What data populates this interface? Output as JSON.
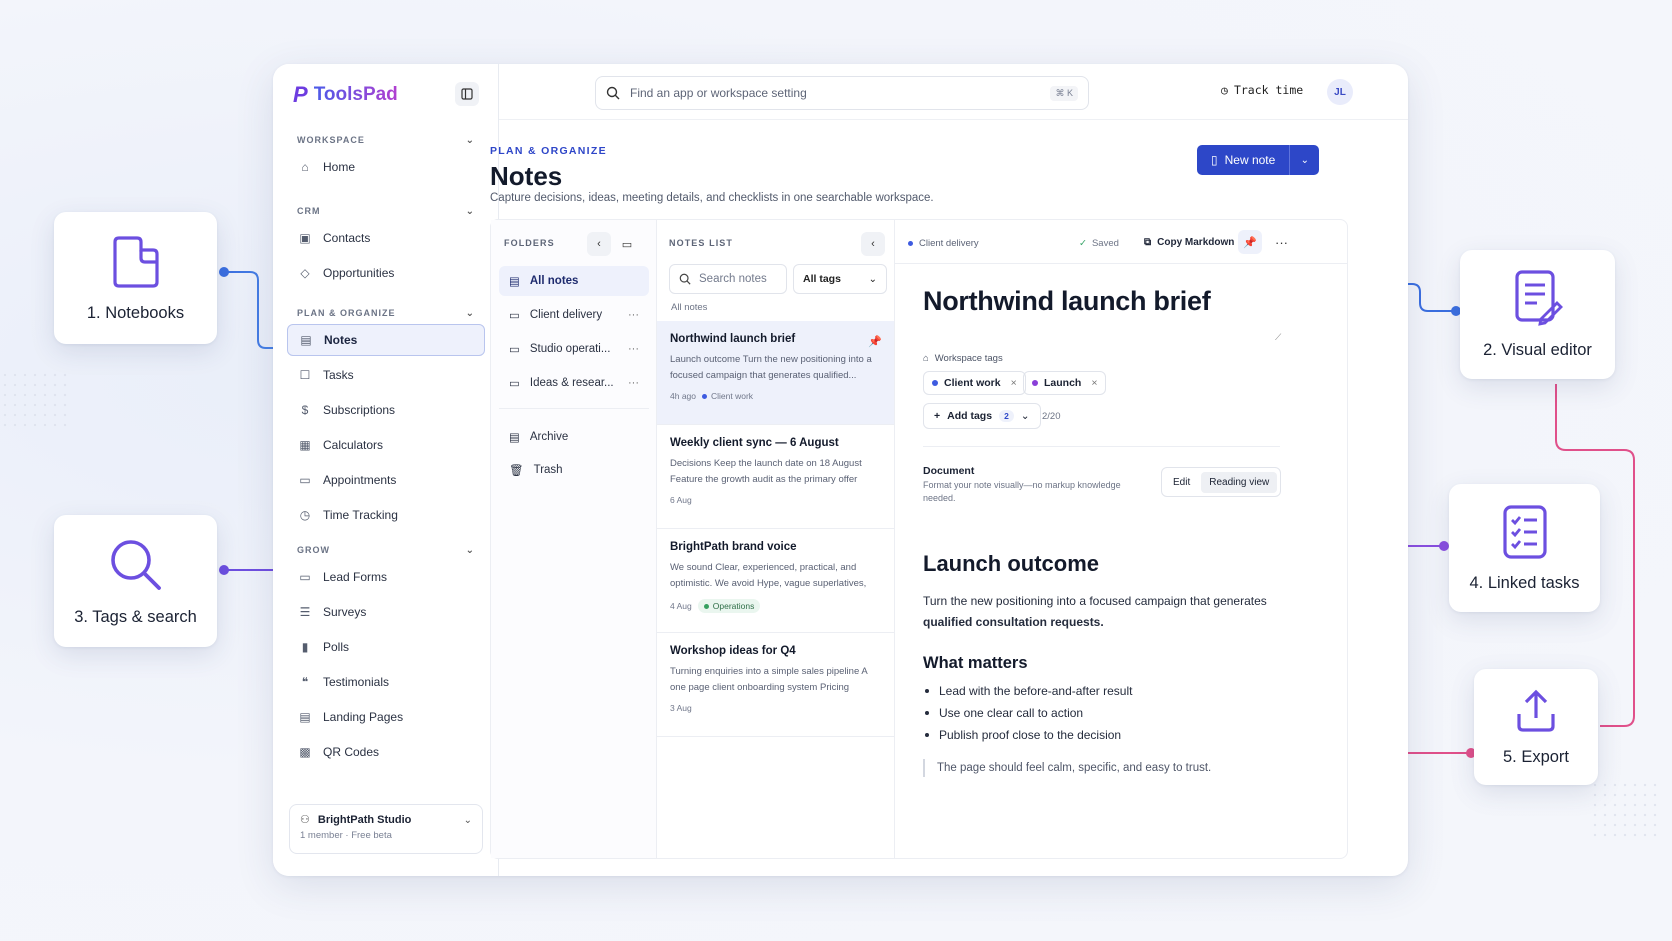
{
  "app": {
    "brand": "ToolsPad",
    "search_placeholder": "Find an app or workspace setting",
    "search_shortcut": "⌘ K",
    "track_time": "Track time",
    "avatar_initials": "JL"
  },
  "sidebar": {
    "sections": [
      {
        "title": "WORKSPACE",
        "items": [
          {
            "label": "Home",
            "icon": "home-icon"
          }
        ]
      },
      {
        "title": "CRM",
        "items": [
          {
            "label": "Contacts",
            "icon": "contacts-icon"
          },
          {
            "label": "Opportunities",
            "icon": "opportunities-icon"
          }
        ]
      },
      {
        "title": "PLAN & ORGANIZE",
        "items": [
          {
            "label": "Notes",
            "icon": "notes-icon",
            "active": true
          },
          {
            "label": "Tasks",
            "icon": "tasks-icon"
          },
          {
            "label": "Subscriptions",
            "icon": "subscriptions-icon"
          },
          {
            "label": "Calculators",
            "icon": "calculator-icon"
          },
          {
            "label": "Appointments",
            "icon": "calendar-icon"
          },
          {
            "label": "Time Tracking",
            "icon": "timer-icon"
          }
        ]
      },
      {
        "title": "GROW",
        "items": [
          {
            "label": "Lead Forms",
            "icon": "form-icon"
          },
          {
            "label": "Surveys",
            "icon": "survey-icon"
          },
          {
            "label": "Polls",
            "icon": "poll-icon"
          },
          {
            "label": "Testimonials",
            "icon": "testimonial-icon"
          },
          {
            "label": "Landing Pages",
            "icon": "landing-page-icon"
          },
          {
            "label": "QR Codes",
            "icon": "qr-icon"
          }
        ]
      }
    ],
    "workspace": {
      "name": "BrightPath Studio",
      "sub": "1 member · Free beta"
    }
  },
  "page": {
    "eyebrow": "PLAN & ORGANIZE",
    "title": "Notes",
    "description": "Capture decisions, ideas, meeting details, and checklists in one searchable workspace.",
    "new_note": "New note"
  },
  "folders": {
    "header": "FOLDERS",
    "items": [
      {
        "label": "All notes",
        "active": true
      },
      {
        "label": "Client delivery"
      },
      {
        "label": "Studio operati..."
      },
      {
        "label": "Ideas & resear..."
      }
    ],
    "archive": "Archive",
    "trash": "Trash"
  },
  "notes_list": {
    "header": "NOTES LIST",
    "search_placeholder": "Search notes",
    "tag_filter": "All tags",
    "crumb": "All notes",
    "notes": [
      {
        "title": "Northwind launch brief",
        "body": "Launch outcome Turn the new positioning into a focused campaign that generates qualified...",
        "time": "4h ago",
        "tag": "Client work",
        "pinned": true
      },
      {
        "title": "Weekly client sync — 6 August",
        "body": "Decisions Keep the launch date on 18 August Feature the growth audit as the primary offer Move...",
        "time": "6 Aug",
        "tag": ""
      },
      {
        "title": "BrightPath brand voice",
        "body": "We sound Clear, experienced, practical, and optimistic. We avoid Hype, vague superlatives, long...",
        "time": "4 Aug",
        "tag": "Operations"
      },
      {
        "title": "Workshop ideas for Q4",
        "body": "Turning enquiries into a simple sales pipeline A one page client onboarding system Pricing creative...",
        "time": "3 Aug",
        "tag": ""
      }
    ]
  },
  "editor": {
    "crumb": "Client delivery",
    "saved": "Saved",
    "copy_markdown": "Copy Markdown",
    "title": "Northwind launch brief",
    "workspace_tags_label": "Workspace tags",
    "tags": [
      {
        "label": "Client work",
        "color": "#3e5be0"
      },
      {
        "label": "Launch",
        "color": "#8a3fd8"
      }
    ],
    "add_tags": "Add tags",
    "add_tags_count": "2",
    "tag_limit": "2/20",
    "document_label": "Document",
    "document_sub": "Format your note visually—no markup knowledge needed.",
    "edit": "Edit",
    "reading_view": "Reading view",
    "h1": "Launch outcome",
    "para_plain": "Turn the new positioning into a focused campaign that generates ",
    "para_bold": "qualified consultation requests.",
    "h2": "What matters",
    "bullets": [
      "Lead with the before-and-after result",
      "Use one clear call to action",
      "Publish proof close to the decision"
    ],
    "quote": "The page should feel calm, specific, and easy to trust."
  },
  "callouts": [
    {
      "label": "1. Notebooks",
      "icon": "folder-icon"
    },
    {
      "label": "2. Visual editor",
      "icon": "document-edit-icon"
    },
    {
      "label": "3. Tags & search",
      "icon": "search-icon"
    },
    {
      "label": "4. Linked tasks",
      "icon": "checklist-icon"
    },
    {
      "label": "5. Export",
      "icon": "export-icon"
    }
  ],
  "colors": {
    "accent": "#2d47c8",
    "callout_purple": "#6c4fe0",
    "connector_blue": "#3b6fe0",
    "connector_pink": "#d65aa5"
  }
}
